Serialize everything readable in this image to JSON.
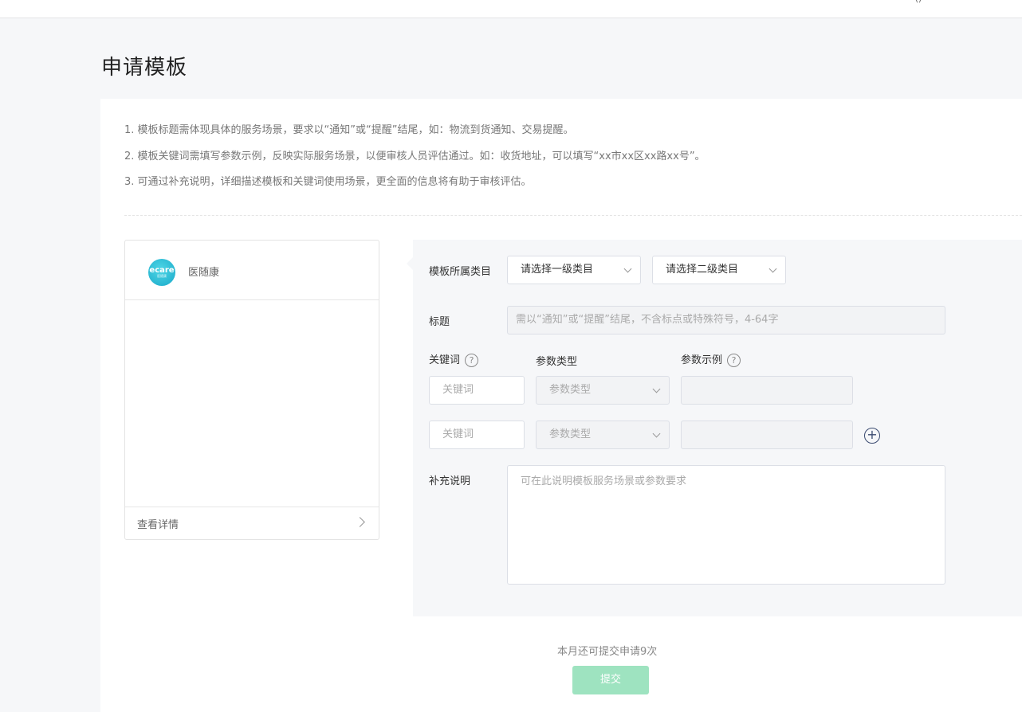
{
  "topbar": {
    "icon": "user-icon"
  },
  "page": {
    "title": "申请模板"
  },
  "tips": [
    "1. 模板标题需体现具体的服务场景，要求以“通知”或“提醒”结尾，如：物流到货通知、交易提醒。",
    "2. 模板关键词需填写参数示例，反映实际服务场景，以便审核人员评估通过。如：收货地址，可以填写“xx市xx区xx路xx号”。",
    "3. 可通过补充说明，详细描述模板和关键词使用场景，更全面的信息将有助于审核评估。"
  ],
  "preview": {
    "avatar_text": "ecare",
    "avatar_subtext": "医随康",
    "app_name": "医随康",
    "details_link": "查看详情"
  },
  "form": {
    "category_label": "模板所属类目",
    "category_primary": "请选择一级类目",
    "category_secondary": "请选择二级类目",
    "title_label": "标题",
    "title_placeholder": "需以“通知”或“提醒”结尾，不含标点或特殊符号，4-64字",
    "keyword_header": "关键词",
    "param_type_header": "参数类型",
    "param_example_header": "参数示例",
    "rows": [
      {
        "keyword_placeholder": "关键词",
        "param_type": "参数类型",
        "example": ""
      },
      {
        "keyword_placeholder": "关键词",
        "param_type": "参数类型",
        "example": ""
      }
    ],
    "note_label": "补充说明",
    "note_placeholder": "可在此说明模板服务场景或参数要求"
  },
  "footer": {
    "quota_text": "本月还可提交申请9次",
    "submit_label": "提交"
  },
  "colors": {
    "submit_bg": "#9ee3c0",
    "avatar": "#18a9c9"
  }
}
